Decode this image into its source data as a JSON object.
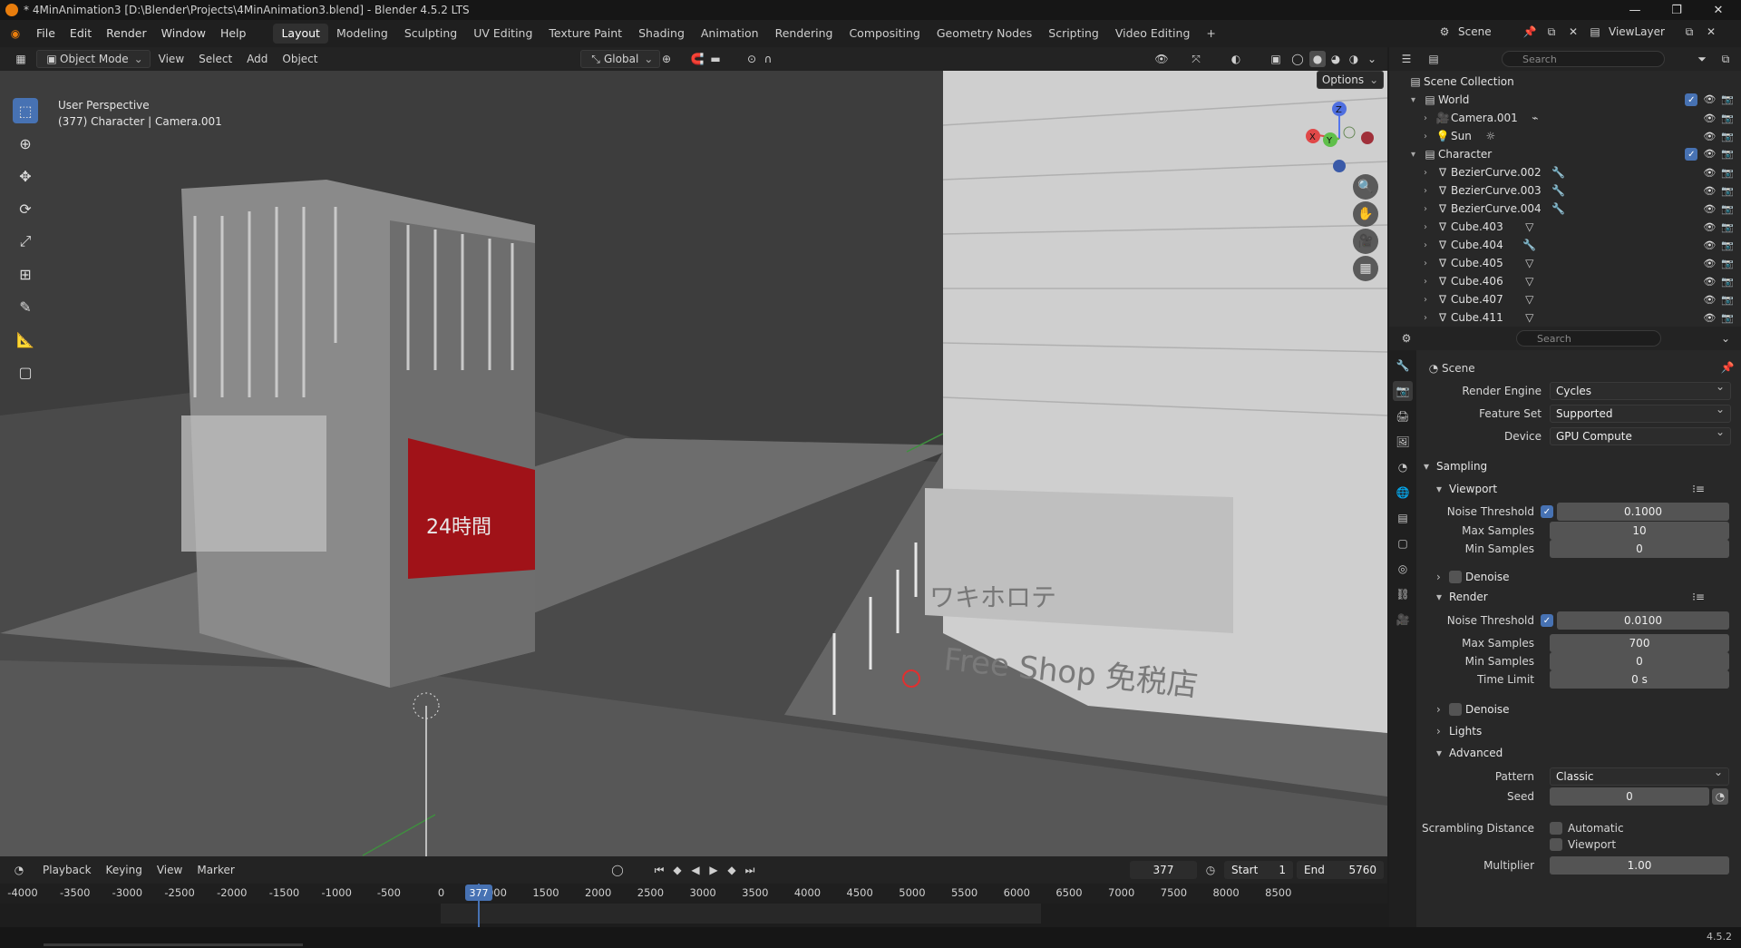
{
  "window": {
    "title": "* 4MinAnimation3 [D:\\Blender\\Projects\\4MinAnimation3.blend] - Blender 4.5.2 LTS"
  },
  "menubar": {
    "menus": [
      "File",
      "Edit",
      "Render",
      "Window",
      "Help"
    ],
    "workspaces": [
      "Layout",
      "Modeling",
      "Sculpting",
      "UV Editing",
      "Texture Paint",
      "Shading",
      "Animation",
      "Rendering",
      "Compositing",
      "Geometry Nodes",
      "Scripting",
      "Video Editing"
    ],
    "add_workspace": "+",
    "scene_name": "Scene",
    "view_layer": "ViewLayer"
  },
  "viewport_header": {
    "mode": "Object Mode",
    "menus": [
      "View",
      "Select",
      "Add",
      "Object"
    ],
    "orientation": "Global",
    "options_label": "Options"
  },
  "viewport": {
    "perspective": "User Perspective",
    "object_info": "(377) Character | Camera.001",
    "sign_text_1": "Free Shop 免税店",
    "sign_text_2": "ワキホロテ",
    "sign_text_3": "24時間",
    "gizmo": {
      "x": "X",
      "y": "Y",
      "z": "Z"
    }
  },
  "outliner": {
    "search_placeholder": "Search",
    "root": "Scene Collection",
    "collections": [
      {
        "name": "World",
        "children": [
          "Camera.001",
          "Sun"
        ]
      },
      {
        "name": "Character",
        "children": [
          "BezierCurve.002",
          "BezierCurve.003",
          "BezierCurve.004",
          "Cube.403",
          "Cube.404",
          "Cube.405",
          "Cube.406",
          "Cube.407",
          "Cube.411"
        ]
      }
    ]
  },
  "properties": {
    "search_placeholder": "Search",
    "context": "Scene",
    "render_engine_label": "Render Engine",
    "render_engine": "Cycles",
    "feature_set_label": "Feature Set",
    "feature_set": "Supported",
    "device_label": "Device",
    "device": "GPU Compute",
    "sampling": "Sampling",
    "viewport_section": "Viewport",
    "noise_threshold_label": "Noise Threshold",
    "viewport_noise_threshold": "0.1000",
    "max_samples_label": "Max Samples",
    "viewport_max_samples": "10",
    "min_samples_label": "Min Samples",
    "viewport_min_samples": "0",
    "denoise": "Denoise",
    "render_section": "Render",
    "render_noise_threshold": "0.0100",
    "render_max_samples": "700",
    "render_min_samples": "0",
    "time_limit_label": "Time Limit",
    "time_limit": "0 s",
    "lights": "Lights",
    "advanced": "Advanced",
    "pattern_label": "Pattern",
    "pattern": "Classic",
    "seed_label": "Seed",
    "seed": "0",
    "scrambling_label": "Scrambling Distance",
    "automatic": "Automatic",
    "viewport_chk": "Viewport",
    "multiplier_label": "Multiplier",
    "multiplier": "1.00"
  },
  "timeline": {
    "menus": [
      "Playback",
      "Keying",
      "View",
      "Marker"
    ],
    "current_frame": "377",
    "start_label": "Start",
    "start": "1",
    "end_label": "End",
    "end": "5760",
    "ruler": [
      "-4000",
      "-3500",
      "-3000",
      "-2500",
      "-2000",
      "-1500",
      "-1000",
      "-500",
      "0",
      "377",
      "1000",
      "1500",
      "2000",
      "2500",
      "3000",
      "3500",
      "4000",
      "4500",
      "5000",
      "5500",
      "6000",
      "6500",
      "7000",
      "7500",
      "8000",
      "8500"
    ]
  },
  "statusbar": {
    "version": "4.5.2"
  },
  "colors": {
    "accent": "#4772b3",
    "playhead": "#4772b3",
    "background": "#3c3c3c"
  }
}
